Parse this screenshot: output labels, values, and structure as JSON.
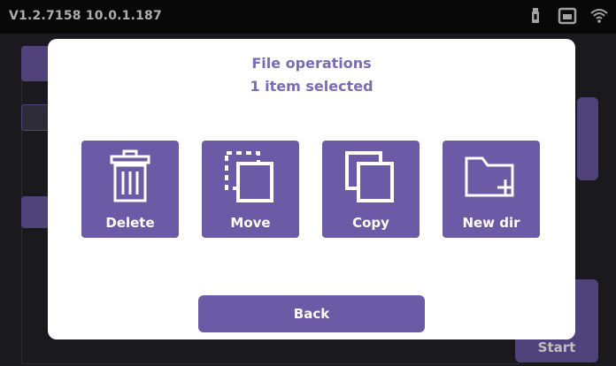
{
  "status_bar": {
    "version_text": "V1.2.7158  10.0.1.187",
    "icons": [
      "usb-icon",
      "ethernet-icon",
      "wifi-icon"
    ]
  },
  "background": {
    "start_label": "Start"
  },
  "dialog": {
    "title": "File operations",
    "subtitle": "1 item selected",
    "operations": [
      {
        "label": "Delete",
        "icon": "trash-icon"
      },
      {
        "label": "Move",
        "icon": "move-icon"
      },
      {
        "label": "Copy",
        "icon": "copy-icon"
      },
      {
        "label": "New dir",
        "icon": "new-folder-icon"
      }
    ],
    "back_label": "Back"
  },
  "colors": {
    "accent": "#6b5aa6",
    "title_text": "#7a6bb7",
    "dialog_bg": "#ffffff",
    "statusbar_bg": "#0b0b0d"
  }
}
